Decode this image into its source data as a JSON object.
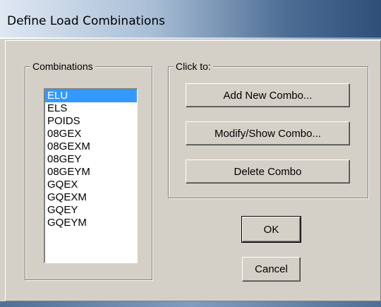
{
  "window": {
    "title": "Define Load Combinations"
  },
  "combinations": {
    "group_label": "Combinations",
    "items": [
      "ELU",
      "ELS",
      "POIDS",
      "08GEX",
      "08GEXM",
      "08GEY",
      "08GEYM",
      "GQEX",
      "GQEXM",
      "GQEY",
      "GQEYM"
    ],
    "selected": "ELU"
  },
  "actions": {
    "group_label": "Click to:",
    "add_label": "Add New Combo...",
    "modify_label": "Modify/Show Combo...",
    "delete_label": "Delete Combo"
  },
  "footer": {
    "ok_label": "OK",
    "cancel_label": "Cancel"
  },
  "colors": {
    "selection": "#3399ff",
    "dialog_bg": "#d4d0c8"
  }
}
